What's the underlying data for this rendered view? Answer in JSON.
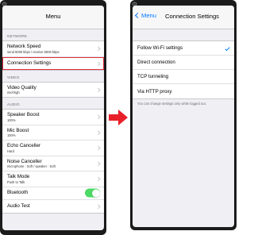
{
  "left": {
    "title": "Menu",
    "sections": [
      {
        "header": "NETWORK",
        "rows": [
          {
            "title": "Network Speed",
            "subtitle": "send 6000 kbps / receive 6000 kbps"
          },
          {
            "title": "Connection Settings",
            "subtitle": ""
          }
        ]
      },
      {
        "header": "VIDEO",
        "rows": [
          {
            "title": "Video Quality",
            "subtitle": "mid-high"
          }
        ]
      },
      {
        "header": "AUDIO",
        "rows": [
          {
            "title": "Speaker Boost",
            "subtitle": "100%"
          },
          {
            "title": "Mic Boost",
            "subtitle": "100%"
          },
          {
            "title": "Echo Canceller",
            "subtitle": "Hard"
          },
          {
            "title": "Noise Canceller",
            "subtitle": "microphone : Soft / speaker : Soft"
          },
          {
            "title": "Talk Mode",
            "subtitle": "Push to Talk"
          },
          {
            "title": "Bluetooth",
            "subtitle": ""
          },
          {
            "title": "Audio Test",
            "subtitle": ""
          }
        ]
      }
    ],
    "bluetooth_on": true
  },
  "right": {
    "back_label": "Menu",
    "title": "Connection Settings",
    "options": [
      {
        "label": "Follow Wi-Fi settings",
        "selected": true
      },
      {
        "label": "Direct connection",
        "selected": false
      },
      {
        "label": "TCP tunneling",
        "selected": false
      },
      {
        "label": "Via HTTP proxy",
        "selected": false
      }
    ],
    "note": "You can change settings only while logged out."
  },
  "colors": {
    "accent": "#007aff",
    "highlight": "#e0303a",
    "toggle_on": "#4cd964",
    "arrow": "#e8202a"
  },
  "icons": {
    "gear": "gear-icon",
    "arrow": "right-arrow-icon"
  }
}
